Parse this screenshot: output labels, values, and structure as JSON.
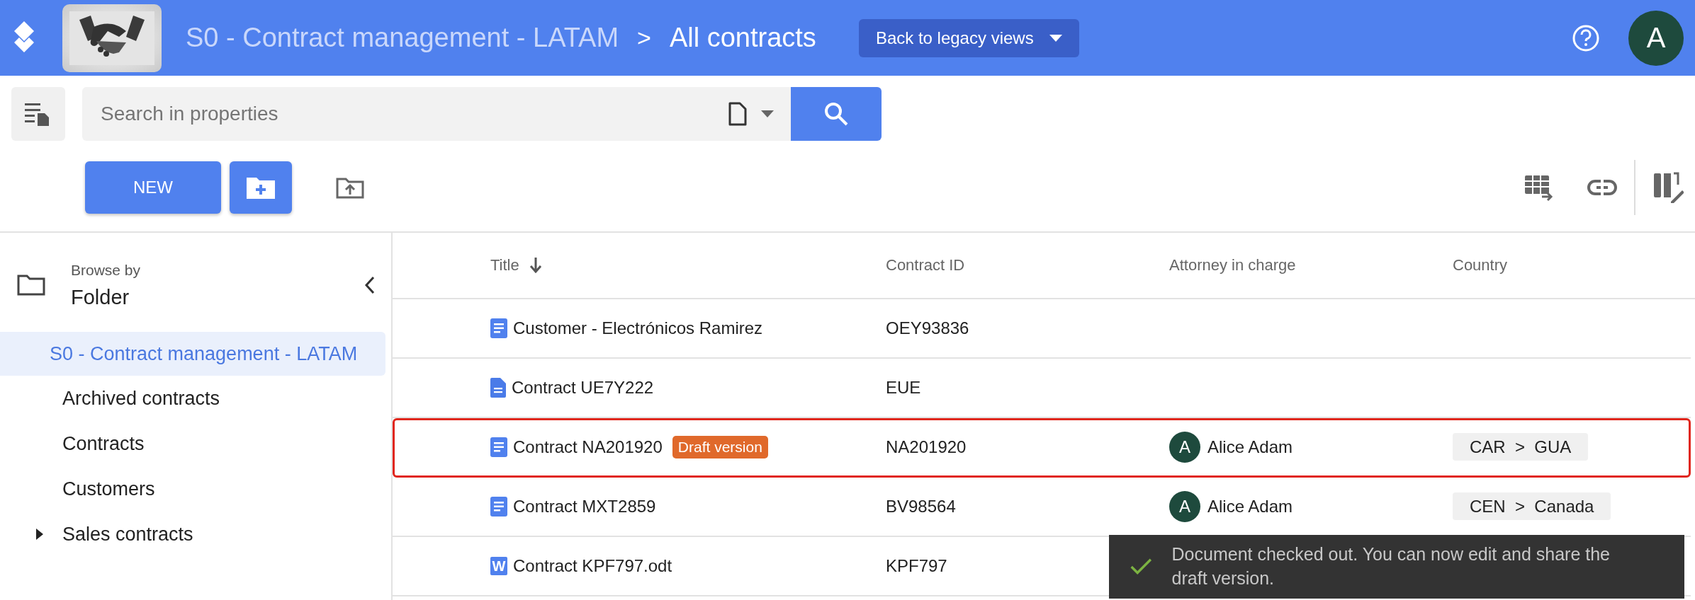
{
  "header": {
    "app_title": "S0 - Contract management - LATAM",
    "separator": ">",
    "page_title": "All contracts",
    "legacy_button": "Back to legacy views",
    "avatar": "A"
  },
  "search": {
    "placeholder": "Search in properties"
  },
  "toolbar": {
    "new_button": "NEW"
  },
  "sidebar": {
    "browse_label": "Browse by",
    "browse_value": "Folder",
    "items": [
      {
        "label": "S0 - Contract management - LATAM",
        "selected": true,
        "expandable": false,
        "children": [
          {
            "label": "Archived contracts",
            "selected": false,
            "expandable": false
          },
          {
            "label": "Contracts",
            "selected": false,
            "expandable": false
          },
          {
            "label": "Customers",
            "selected": false,
            "expandable": false
          },
          {
            "label": "Sales contracts",
            "selected": false,
            "expandable": true
          }
        ]
      }
    ]
  },
  "table": {
    "columns": [
      {
        "label": "Title",
        "sorted": true
      },
      {
        "label": "Contract ID",
        "sorted": false
      },
      {
        "label": "Attorney in charge",
        "sorted": false
      },
      {
        "label": "Country",
        "sorted": false
      }
    ],
    "rows": [
      {
        "kind": "note",
        "title": "Customer - Electrónicos Ramirez",
        "contract_id": "OEY93836",
        "highlighted": false
      },
      {
        "kind": "page",
        "title": "Contract UE7Y222",
        "contract_id": "EUE",
        "highlighted": false
      },
      {
        "kind": "note",
        "title": "Contract NA201920",
        "badge": "Draft version",
        "contract_id": "NA201920",
        "attorney": {
          "initial": "A",
          "name": "Alice Adam"
        },
        "country": "CAR  >  GUA",
        "highlighted": true
      },
      {
        "kind": "note",
        "title": "Contract MXT2859",
        "contract_id": "BV98564",
        "attorney": {
          "initial": "A",
          "name": "Alice Adam"
        },
        "country": "CEN  >  Canada",
        "highlighted": false
      },
      {
        "kind": "word",
        "title": "Contract KPF797.odt",
        "word_letter": "W",
        "contract_id": "KPF797",
        "highlighted": false
      }
    ]
  },
  "toast": {
    "message": "Document checked out. You can now edit and share the draft version."
  }
}
